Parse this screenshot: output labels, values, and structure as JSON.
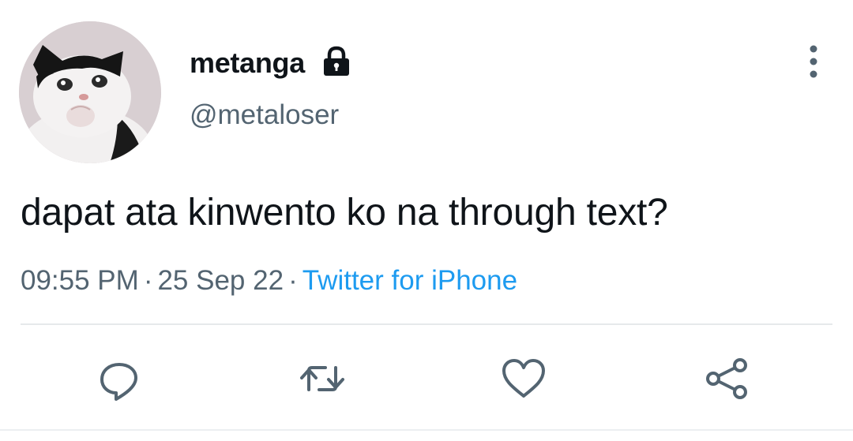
{
  "user": {
    "display_name": "metanga",
    "handle": "@metaloser",
    "protected_icon": "lock-icon",
    "avatar_icon": "cat-avatar"
  },
  "tweet": {
    "text": "dapat ata kinwento ko na through text?",
    "time": "09:55 PM",
    "date": "25 Sep 22",
    "separator": "·",
    "source": "Twitter for iPhone"
  },
  "actions": [
    {
      "name": "reply",
      "icon": "reply-icon"
    },
    {
      "name": "retweet",
      "icon": "retweet-icon"
    },
    {
      "name": "like",
      "icon": "heart-icon"
    },
    {
      "name": "share",
      "icon": "share-icon"
    }
  ],
  "colors": {
    "text": "#0f1419",
    "secondary": "#536471",
    "link": "#1d9bf0",
    "icon": "#536471",
    "divider": "#e6e9eb"
  }
}
